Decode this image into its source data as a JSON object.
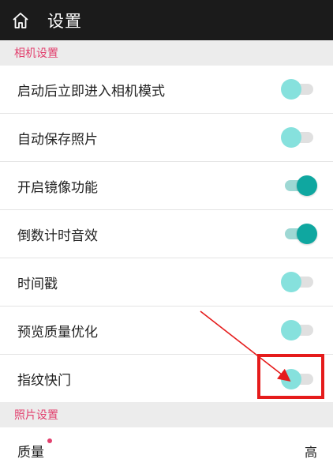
{
  "header": {
    "title": "设置",
    "icon": "home-icon"
  },
  "sections": {
    "camera": {
      "title": "相机设置"
    },
    "photo": {
      "title": "照片设置"
    }
  },
  "settings": [
    {
      "label": "启动后立即进入相机模式",
      "state": "off"
    },
    {
      "label": "自动保存照片",
      "state": "off"
    },
    {
      "label": "开启镜像功能",
      "state": "on"
    },
    {
      "label": "倒数计时音效",
      "state": "on"
    },
    {
      "label": "时间戳",
      "state": "off"
    },
    {
      "label": "预览质量优化",
      "state": "off"
    },
    {
      "label": "指纹快门",
      "state": "off"
    }
  ],
  "quality": {
    "label": "质量",
    "value": "高"
  },
  "colors": {
    "accent": "#e2406e",
    "switch_on": "#0fa7a0",
    "switch_off_knob": "#86e1dd",
    "annotation": "#e51b1b"
  }
}
